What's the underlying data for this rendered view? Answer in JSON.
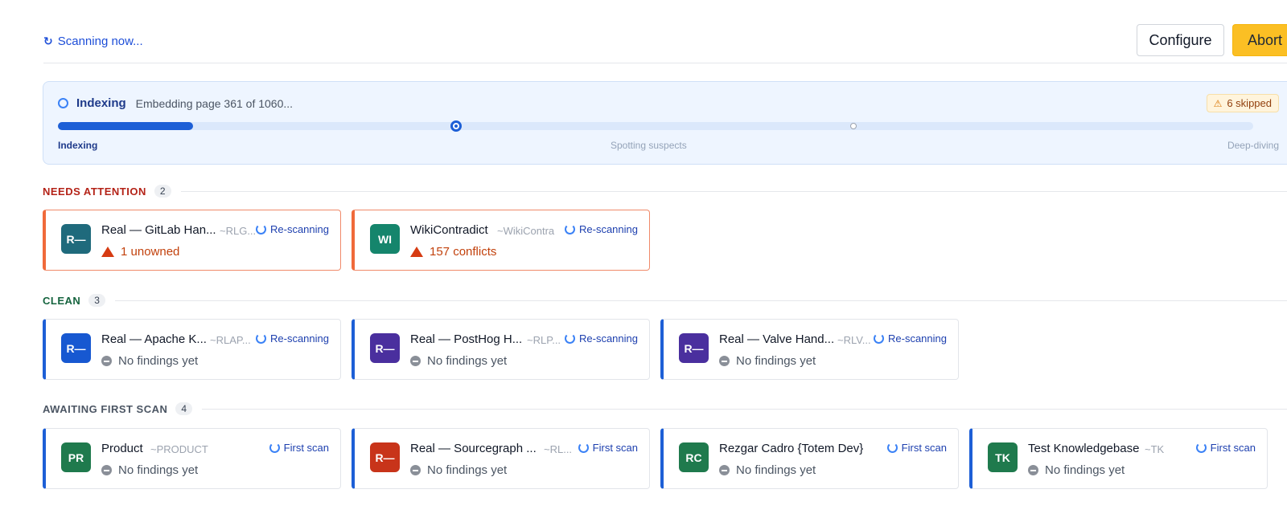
{
  "header": {
    "scan_status": "Scanning now...",
    "configure_label": "Configure",
    "abort_label": "Abort"
  },
  "progress": {
    "title": "Indexing",
    "subtitle": "Embedding page 361 of 1060...",
    "skipped_label": "6 skipped",
    "fill_fraction": 0.113,
    "stages": [
      "Indexing",
      "Spotting suspects",
      "Deep-diving"
    ]
  },
  "sections": {
    "attention": {
      "title": "NEEDS ATTENTION",
      "count": "2",
      "cards": [
        {
          "initials": "R—",
          "color": "#1f6a7c",
          "name": "Real — GitLab Han...",
          "slug": "~RLG...",
          "status": "Re-scanning",
          "finding": "1 unowned"
        },
        {
          "initials": "WI",
          "color": "#15856c",
          "name": "WikiContradict",
          "slug": "~WikiContra",
          "status": "Re-scanning",
          "finding": "157 conflicts"
        }
      ]
    },
    "clean": {
      "title": "CLEAN",
      "count": "3",
      "cards": [
        {
          "initials": "R—",
          "color": "#1758d1",
          "name": "Real — Apache K...",
          "slug": "~RLAP...",
          "status": "Re-scanning",
          "finding": "No findings yet"
        },
        {
          "initials": "R—",
          "color": "#4a2f9e",
          "name": "Real — PostHog H...",
          "slug": "~RLP...",
          "status": "Re-scanning",
          "finding": "No findings yet"
        },
        {
          "initials": "R—",
          "color": "#4a2f9e",
          "name": "Real — Valve Hand...",
          "slug": "~RLV...",
          "status": "Re-scanning",
          "finding": "No findings yet"
        }
      ]
    },
    "awaiting": {
      "title": "AWAITING FIRST SCAN",
      "count": "4",
      "cards": [
        {
          "initials": "PR",
          "color": "#1f7a4d",
          "name": "Product",
          "slug": "~PRODUCT",
          "status": "First scan",
          "finding": "No findings yet"
        },
        {
          "initials": "R—",
          "color": "#c8341a",
          "name": "Real — Sourcegraph ...",
          "slug": "~RL...",
          "status": "First scan",
          "finding": "No findings yet"
        },
        {
          "initials": "RC",
          "color": "#1f7a4d",
          "name": "Rezgar Cadro {Totem Dev}",
          "slug": "",
          "status": "First scan",
          "finding": "No findings yet"
        },
        {
          "initials": "TK",
          "color": "#1f7a4d",
          "name": "Test Knowledgebase",
          "slug": "~TK",
          "status": "First scan",
          "finding": "No findings yet"
        }
      ]
    }
  }
}
